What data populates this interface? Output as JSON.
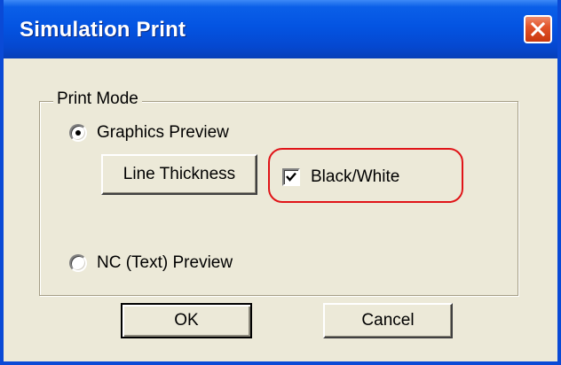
{
  "window": {
    "title": "Simulation Print",
    "close_icon": "close-icon"
  },
  "group": {
    "legend": "Print Mode"
  },
  "options": {
    "graphics_preview": {
      "label": "Graphics Preview",
      "selected": true
    },
    "nc_preview": {
      "label": "NC (Text) Preview",
      "selected": false
    }
  },
  "buttons": {
    "line_thickness": "Line Thickness",
    "ok": "OK",
    "cancel": "Cancel"
  },
  "checkbox": {
    "label": "Black/White",
    "checked": true
  },
  "colors": {
    "titlebar": "#0454e2",
    "dialog_bg": "#ece9d8",
    "highlight": "#e01418"
  }
}
